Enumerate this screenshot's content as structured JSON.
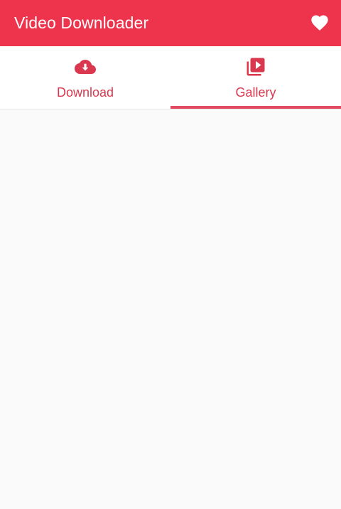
{
  "app": {
    "title": "Video Downloader",
    "accent_color": "#ee344d",
    "tab_text_color": "#d9384f",
    "background_color": "#fafafa"
  },
  "toolbar": {
    "action_icon": "heart-icon"
  },
  "tabs": [
    {
      "label": "Download",
      "icon": "cloud-download-icon",
      "selected": false
    },
    {
      "label": "Gallery",
      "icon": "video-library-icon",
      "selected": true
    }
  ]
}
